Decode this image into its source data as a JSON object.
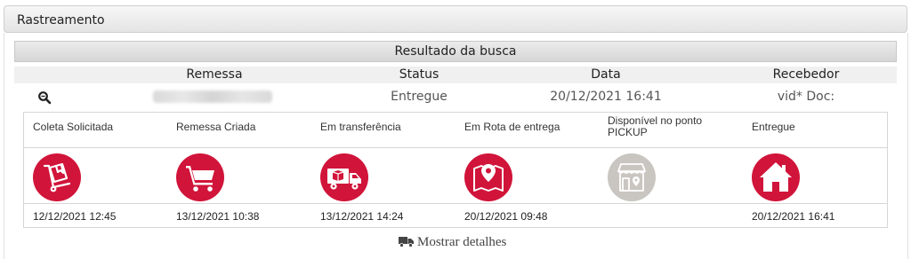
{
  "panel": {
    "title": "Rastreamento"
  },
  "results": {
    "title": "Resultado da busca",
    "columns": {
      "remessa": "Remessa",
      "status": "Status",
      "data": "Data",
      "recebedor": "Recebedor"
    },
    "row": {
      "status": "Entregue",
      "data": "20/12/2021 16:41",
      "recebedor": "vid* Doc:"
    }
  },
  "steps": [
    {
      "label": "Coleta Solicitada",
      "date": "12/12/2021 12:45",
      "icon": "package-on-cart-icon",
      "done": true
    },
    {
      "label": "Remessa Criada",
      "date": "13/12/2021 10:38",
      "icon": "shopping-cart-icon",
      "done": true
    },
    {
      "label": "Em transferência",
      "date": "13/12/2021 14:24",
      "icon": "delivery-truck-icon",
      "done": true
    },
    {
      "label": "Em Rota de entrega",
      "date": "20/12/2021 09:48",
      "icon": "map-pin-icon",
      "done": true
    },
    {
      "label": "Disponível no ponto PICKUP",
      "date": "",
      "icon": "store-pin-icon",
      "done": false
    },
    {
      "label": "Entregue",
      "date": "20/12/2021 16:41",
      "icon": "home-icon",
      "done": true
    }
  ],
  "details_link": "Mostrar detalhes",
  "colors": {
    "accent": "#d1143a",
    "inactive": "#c9c5c0"
  }
}
